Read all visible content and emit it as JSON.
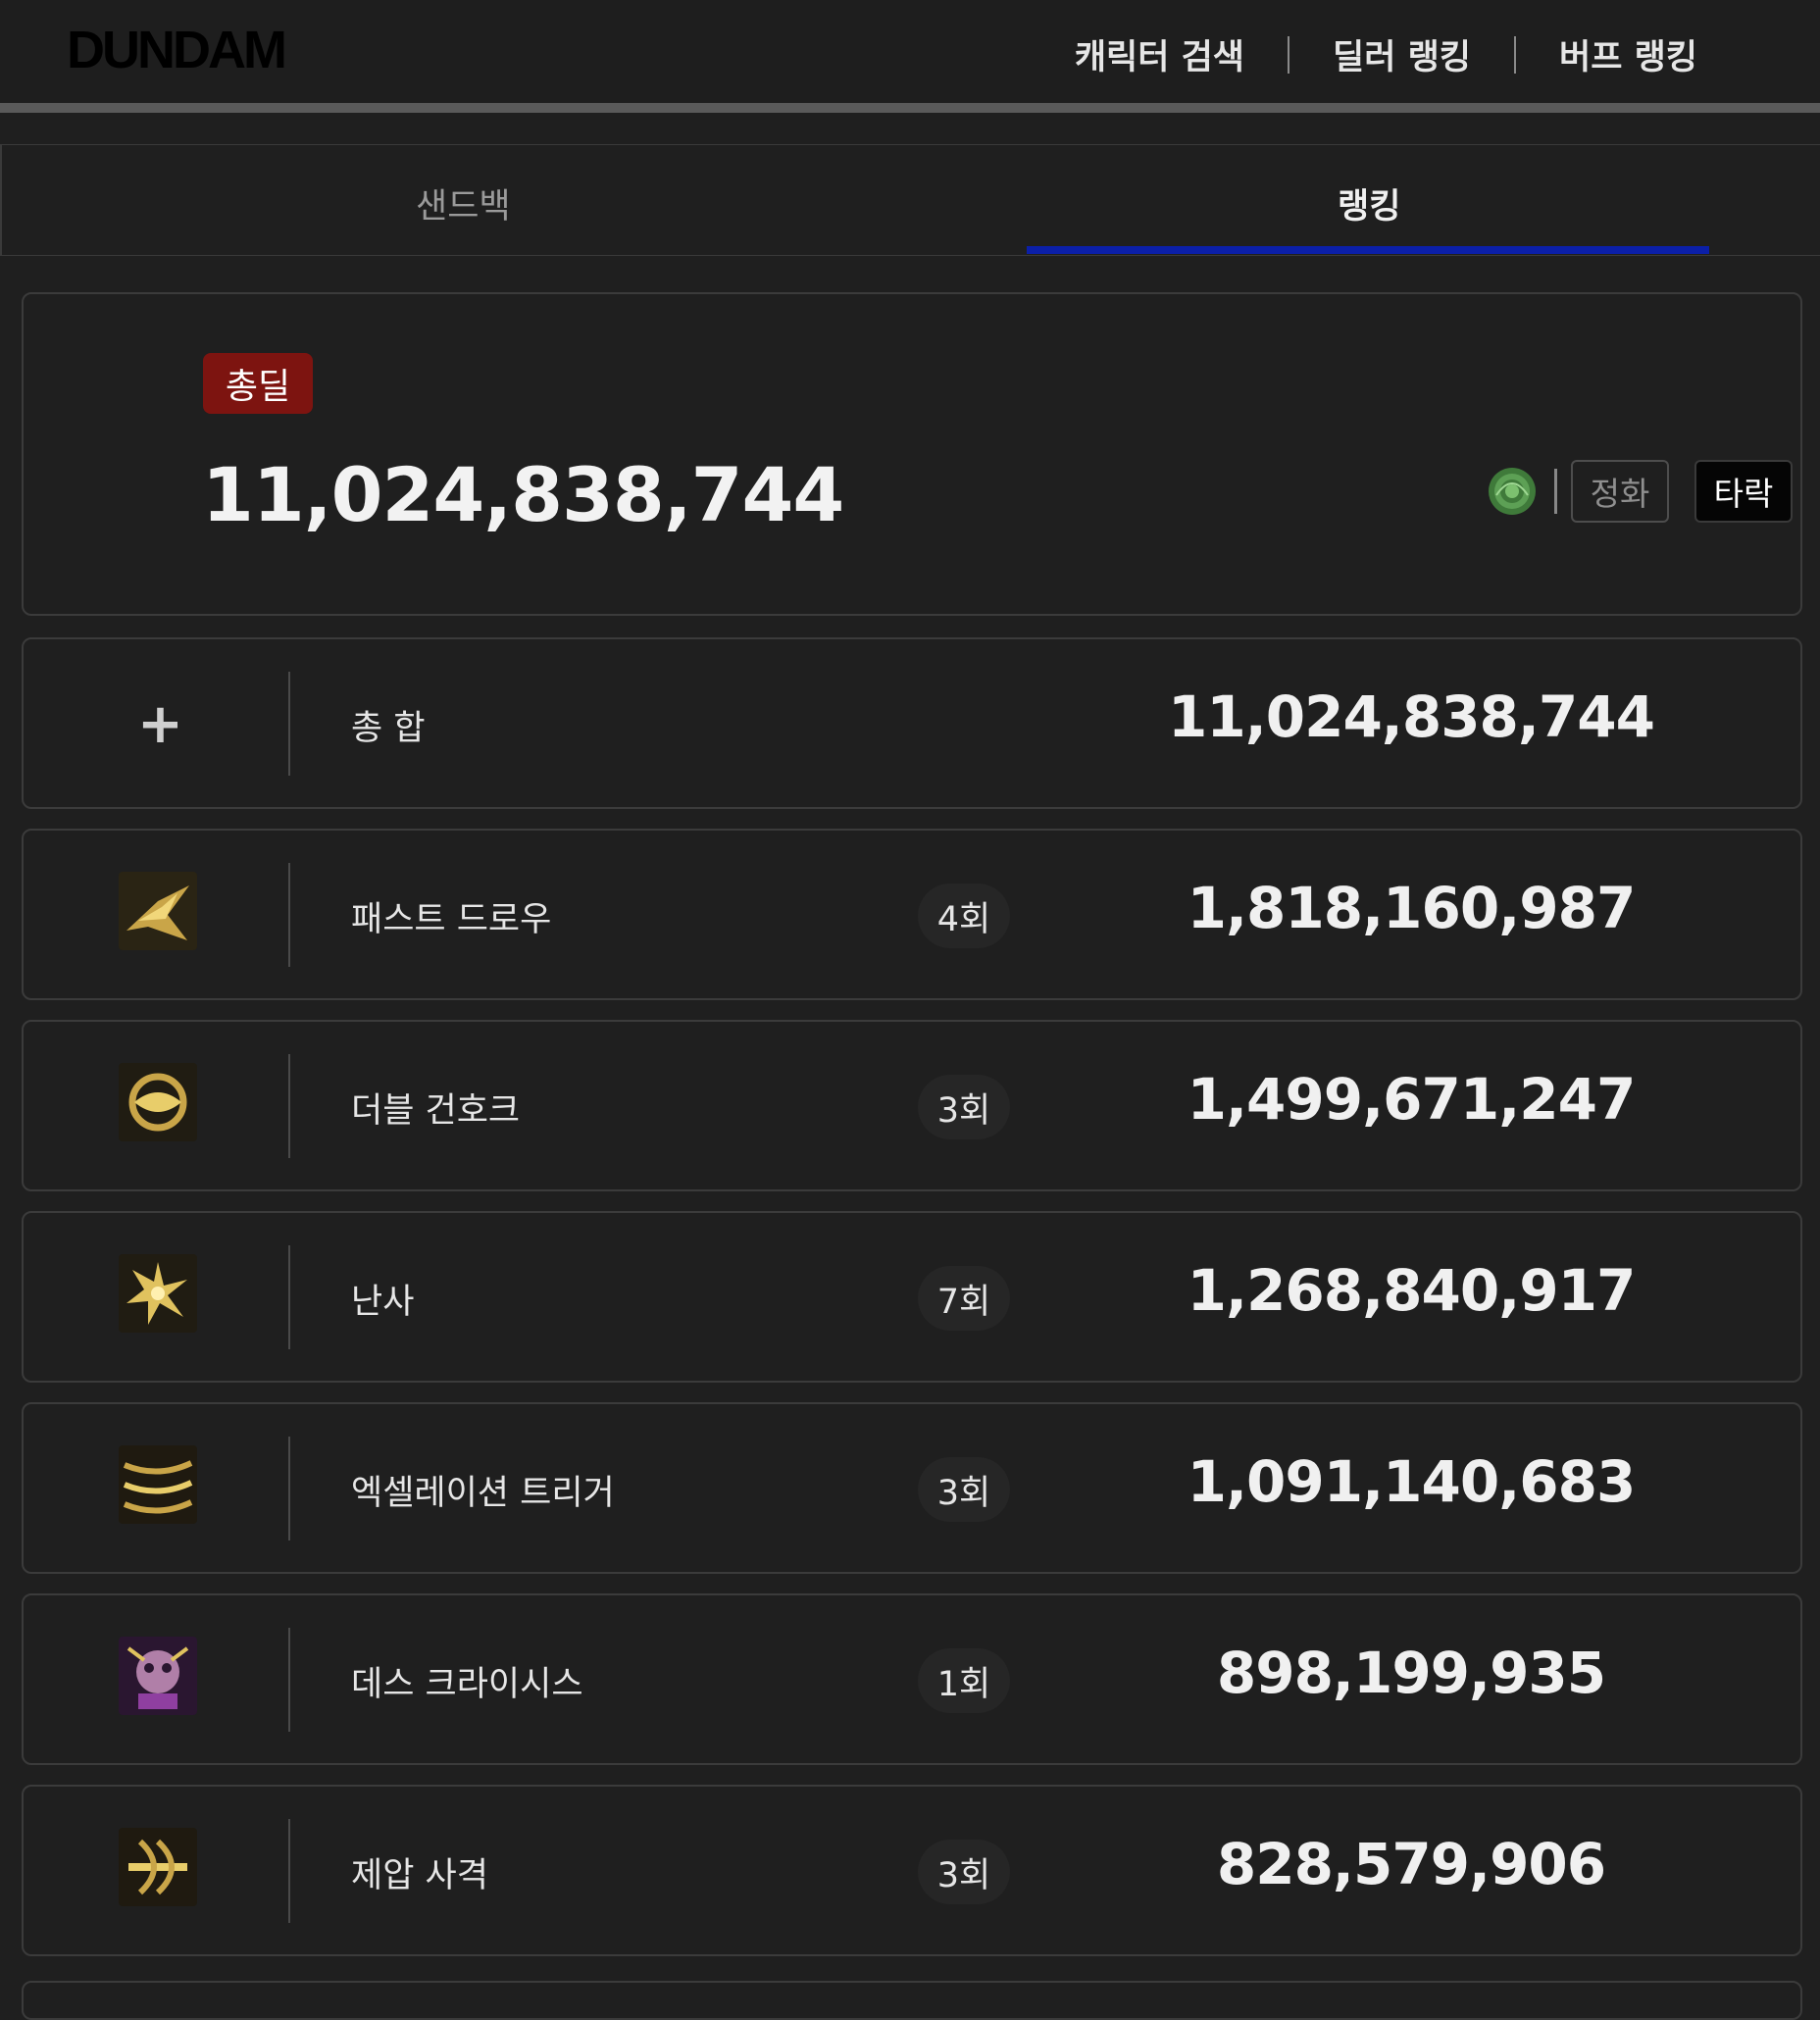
{
  "header": {
    "logo": "DUNDAM",
    "nav": [
      "캐릭터 검색",
      "딜러 랭킹",
      "버프 랭킹"
    ]
  },
  "tabs": {
    "sandbag": "샌드백",
    "ranking": "랭킹",
    "active": "랭킹"
  },
  "total": {
    "badge": "총딜",
    "value": "11,024,838,744",
    "mode_inactive": "정화",
    "mode_active": "타락",
    "element_icon": "green-rose-icon"
  },
  "rows": [
    {
      "name": "총 합",
      "hits": "",
      "damage": "11,024,838,744",
      "icon": "plus-icon"
    },
    {
      "name": "패스트 드로우",
      "hits": "4회",
      "damage": "1,818,160,987",
      "icon": "fast-draw-skill-icon"
    },
    {
      "name": "더블 건호크",
      "hits": "3회",
      "damage": "1,499,671,247",
      "icon": "double-gunhawk-skill-icon"
    },
    {
      "name": "난사",
      "hits": "7회",
      "damage": "1,268,840,917",
      "icon": "random-shot-skill-icon"
    },
    {
      "name": "엑셀레이션 트리거",
      "hits": "3회",
      "damage": "1,091,140,683",
      "icon": "acceleration-trigger-skill-icon"
    },
    {
      "name": "데스 크라이시스",
      "hits": "1회",
      "damage": "898,199,935",
      "icon": "death-crisis-skill-icon"
    },
    {
      "name": "제압 사격",
      "hits": "3회",
      "damage": "828,579,906",
      "icon": "suppression-fire-skill-icon"
    }
  ],
  "colors": {
    "background": "#1f1f1f",
    "badge": "#7d1410",
    "tab_underline": "#0b1fa8",
    "border": "#3b3b3b"
  }
}
